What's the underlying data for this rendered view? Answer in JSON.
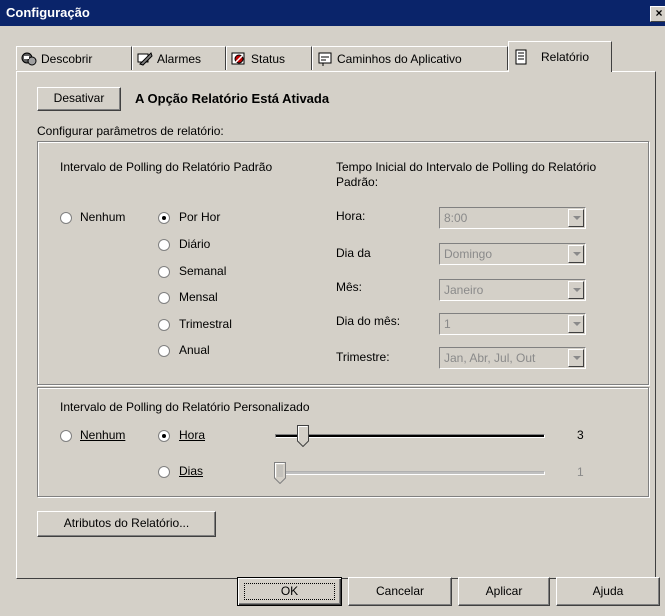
{
  "window": {
    "title": "Configuração",
    "close": "×"
  },
  "tabs": [
    {
      "label": "Descobrir",
      "icon": "discover-icon",
      "active": false
    },
    {
      "label": "Alarmes",
      "icon": "alarms-icon",
      "active": false
    },
    {
      "label": "Status",
      "icon": "status-icon",
      "active": false
    },
    {
      "label": "Caminhos do Aplicativo",
      "icon": "app-paths-icon",
      "active": false
    },
    {
      "label": "Relatório",
      "icon": "report-icon",
      "active": true
    }
  ],
  "report": {
    "disable_button": "Desativar",
    "status_text": "A Opção Relatório Está Ativada",
    "config_label": "Configurar parâmetros de relatório:"
  },
  "default_group": {
    "title": "Intervalo de Polling do Relatório Padrão",
    "radios": [
      {
        "label": "Nenhum",
        "selected": false
      },
      {
        "label": "Por Hor",
        "selected": true
      },
      {
        "label": "Diário",
        "selected": false
      },
      {
        "label": "Semanal",
        "selected": false
      },
      {
        "label": "Mensal",
        "selected": false
      },
      {
        "label": "Trimestral",
        "selected": false
      },
      {
        "label": "Anual",
        "selected": false
      }
    ],
    "start_title": "Tempo Inicial do Intervalo de Polling do Relatório Padrão:",
    "fields": [
      {
        "label": "Hora:",
        "value": "8:00"
      },
      {
        "label": "Dia da",
        "value": "Domingo"
      },
      {
        "label": "Mês:",
        "value": "Janeiro"
      },
      {
        "label": "Dia do mês:",
        "value": "1"
      },
      {
        "label": "Trimestre:",
        "value": "Jan, Abr, Jul, Out"
      }
    ]
  },
  "custom_group": {
    "title": "Intervalo de Polling do Relatório Personalizado",
    "none_label": "Nenhum",
    "hour_label": "Hora",
    "days_label": "Dias",
    "hour_selected": true,
    "hour_value": "3",
    "days_value": "1"
  },
  "attributes_button": "Atributos do Relatório...",
  "footer": {
    "ok": "OK",
    "cancel": "Cancelar",
    "apply": "Aplicar",
    "help": "Ajuda"
  }
}
